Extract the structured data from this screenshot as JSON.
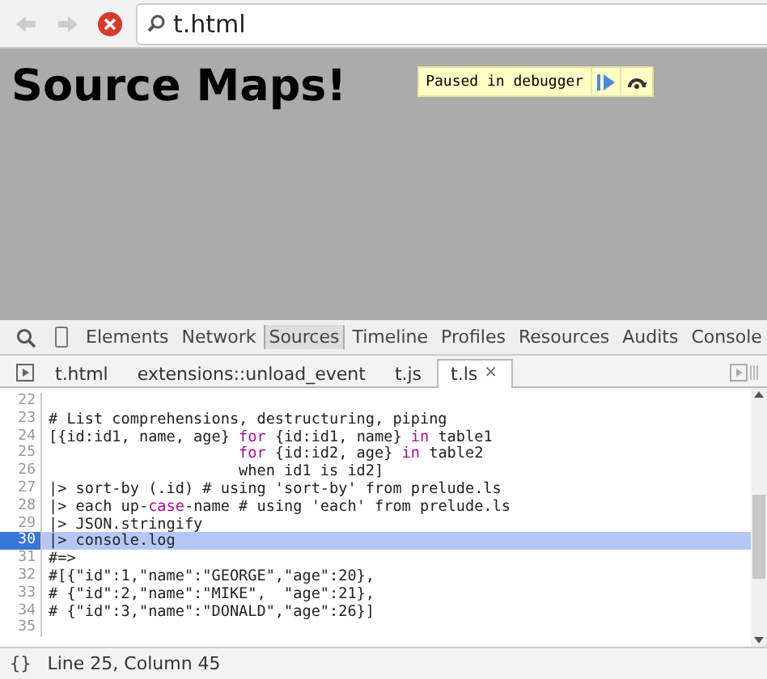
{
  "address_bar": {
    "url": "t.html"
  },
  "page": {
    "heading": "Source Maps!",
    "debugger_banner": {
      "label": "Paused in debugger"
    }
  },
  "devtools_tabs": [
    {
      "label": "Elements",
      "selected": false
    },
    {
      "label": "Network",
      "selected": false
    },
    {
      "label": "Sources",
      "selected": true
    },
    {
      "label": "Timeline",
      "selected": false
    },
    {
      "label": "Profiles",
      "selected": false
    },
    {
      "label": "Resources",
      "selected": false
    },
    {
      "label": "Audits",
      "selected": false
    },
    {
      "label": "Console",
      "selected": false
    }
  ],
  "file_tabs": [
    {
      "label": "t.html",
      "selected": false
    },
    {
      "label": "extensions::unload_event",
      "selected": false
    },
    {
      "label": "t.js",
      "selected": false
    },
    {
      "label": "t.ls",
      "selected": true,
      "close": "×"
    }
  ],
  "code_lines": [
    {
      "number": "22",
      "selected": false
    },
    {
      "number": "23",
      "selected": false,
      "segments": [
        {
          "kind": "plain",
          "text": "# List comprehensions, destructuring, piping"
        }
      ]
    },
    {
      "number": "24",
      "selected": false,
      "segments": [
        {
          "kind": "plain",
          "text": "[{id:id1, name, age} "
        },
        {
          "kind": "keyword",
          "text": "for"
        },
        {
          "kind": "plain",
          "text": " {id:id1, name} "
        },
        {
          "kind": "keyword",
          "text": "in"
        },
        {
          "kind": "plain",
          "text": " table1"
        }
      ]
    },
    {
      "number": "25",
      "selected": false,
      "indented": true,
      "segments": [
        {
          "kind": "keyword",
          "text": "for"
        },
        {
          "kind": "plain",
          "text": " {id:id2, age} "
        },
        {
          "kind": "keyword",
          "text": "in"
        },
        {
          "kind": "plain",
          "text": " table2"
        }
      ]
    },
    {
      "number": "26",
      "selected": false,
      "indented": true,
      "segments": [
        {
          "kind": "plain",
          "text": "when id1 is id2]"
        }
      ]
    },
    {
      "number": "27",
      "selected": false,
      "segments": [
        {
          "kind": "plain",
          "text": "|> sort-by (.id) # using 'sort-by' from prelude.ls"
        }
      ]
    },
    {
      "number": "28",
      "selected": false,
      "segments": [
        {
          "kind": "plain",
          "text": "|> each up-"
        },
        {
          "kind": "keyword",
          "text": "case"
        },
        {
          "kind": "plain",
          "text": "-name # using 'each' from prelude.ls"
        }
      ]
    },
    {
      "number": "29",
      "selected": false,
      "segments": [
        {
          "kind": "plain",
          "text": "|> JSON.stringify"
        }
      ]
    },
    {
      "number": "30",
      "selected": true,
      "segments": [
        {
          "kind": "plain",
          "text": "|> console.log"
        }
      ]
    },
    {
      "number": "31",
      "selected": false,
      "segments": [
        {
          "kind": "plain",
          "text": "#=>"
        }
      ]
    },
    {
      "number": "32",
      "selected": false,
      "segments": [
        {
          "kind": "plain",
          "text": "#[{\"id\":1,\"name\":\"GEORGE\",\"age\":20},"
        }
      ]
    },
    {
      "number": "33",
      "selected": false,
      "segments": [
        {
          "kind": "plain",
          "text": "# {\"id\":2,\"name\":\"MIKE\",  \"age\":21},"
        }
      ]
    },
    {
      "number": "34",
      "selected": false,
      "segments": [
        {
          "kind": "plain",
          "text": "# {\"id\":3,\"name\":\"DONALD\",\"age\":26}]"
        }
      ]
    },
    {
      "number": "35",
      "selected": false
    }
  ],
  "status_bar": {
    "pretty_print": "{}",
    "position": "Line 25, Column 45"
  }
}
